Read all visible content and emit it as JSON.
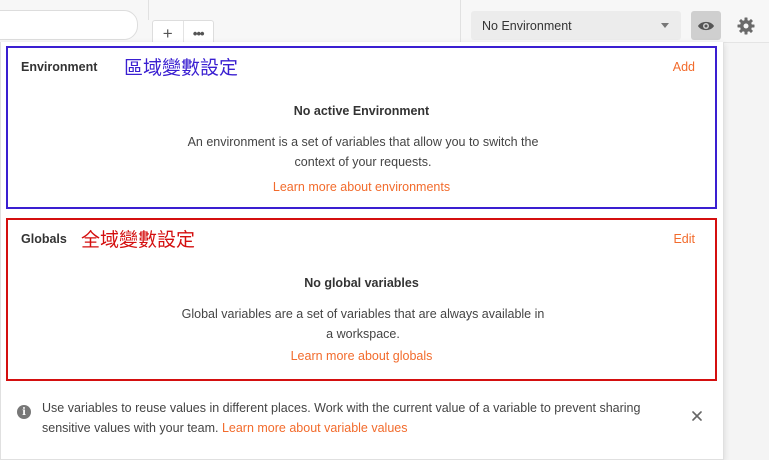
{
  "toolbar": {
    "add_label": "+",
    "more_label": "•••",
    "environment_select": "No Environment"
  },
  "environment_section": {
    "title": "Environment",
    "annotation": "區域變數設定",
    "action": "Add",
    "heading": "No active Environment",
    "description": "An environment is a set of variables that allow you to switch the context of your requests.",
    "link": "Learn more about environments",
    "outline_color": "#3a1fd1"
  },
  "globals_section": {
    "title": "Globals",
    "annotation": "全域變數設定",
    "action": "Edit",
    "heading": "No global variables",
    "description": "Global variables are a set of variables that are always available in a workspace.",
    "link": "Learn more about globals",
    "outline_color": "#d40f0f"
  },
  "info": {
    "icon": "info-icon",
    "icon_glyph": "i",
    "text": "Use variables to reuse values in different places. Work with the current value of a variable to prevent sharing sensitive values with your team. ",
    "link": "Learn more about variable values"
  },
  "colors": {
    "link": "#f26b2c",
    "eye_button_bg": "#cfcfcf"
  }
}
